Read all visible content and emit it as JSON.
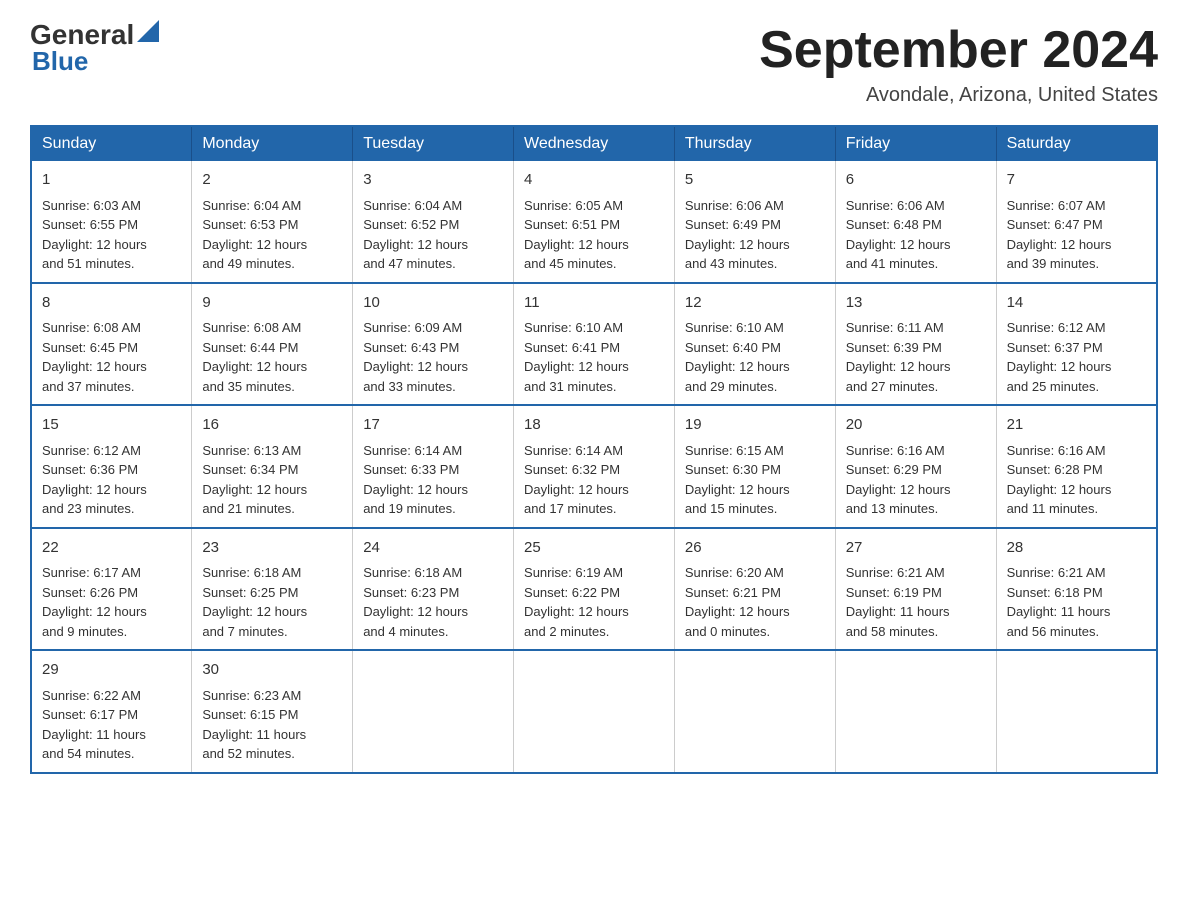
{
  "header": {
    "logo_line1": "General",
    "logo_line2": "Blue",
    "month_title": "September 2024",
    "location": "Avondale, Arizona, United States"
  },
  "days_of_week": [
    "Sunday",
    "Monday",
    "Tuesday",
    "Wednesday",
    "Thursday",
    "Friday",
    "Saturday"
  ],
  "weeks": [
    [
      {
        "day": "1",
        "sunrise": "6:03 AM",
        "sunset": "6:55 PM",
        "daylight": "12 hours and 51 minutes."
      },
      {
        "day": "2",
        "sunrise": "6:04 AM",
        "sunset": "6:53 PM",
        "daylight": "12 hours and 49 minutes."
      },
      {
        "day": "3",
        "sunrise": "6:04 AM",
        "sunset": "6:52 PM",
        "daylight": "12 hours and 47 minutes."
      },
      {
        "day": "4",
        "sunrise": "6:05 AM",
        "sunset": "6:51 PM",
        "daylight": "12 hours and 45 minutes."
      },
      {
        "day": "5",
        "sunrise": "6:06 AM",
        "sunset": "6:49 PM",
        "daylight": "12 hours and 43 minutes."
      },
      {
        "day": "6",
        "sunrise": "6:06 AM",
        "sunset": "6:48 PM",
        "daylight": "12 hours and 41 minutes."
      },
      {
        "day": "7",
        "sunrise": "6:07 AM",
        "sunset": "6:47 PM",
        "daylight": "12 hours and 39 minutes."
      }
    ],
    [
      {
        "day": "8",
        "sunrise": "6:08 AM",
        "sunset": "6:45 PM",
        "daylight": "12 hours and 37 minutes."
      },
      {
        "day": "9",
        "sunrise": "6:08 AM",
        "sunset": "6:44 PM",
        "daylight": "12 hours and 35 minutes."
      },
      {
        "day": "10",
        "sunrise": "6:09 AM",
        "sunset": "6:43 PM",
        "daylight": "12 hours and 33 minutes."
      },
      {
        "day": "11",
        "sunrise": "6:10 AM",
        "sunset": "6:41 PM",
        "daylight": "12 hours and 31 minutes."
      },
      {
        "day": "12",
        "sunrise": "6:10 AM",
        "sunset": "6:40 PM",
        "daylight": "12 hours and 29 minutes."
      },
      {
        "day": "13",
        "sunrise": "6:11 AM",
        "sunset": "6:39 PM",
        "daylight": "12 hours and 27 minutes."
      },
      {
        "day": "14",
        "sunrise": "6:12 AM",
        "sunset": "6:37 PM",
        "daylight": "12 hours and 25 minutes."
      }
    ],
    [
      {
        "day": "15",
        "sunrise": "6:12 AM",
        "sunset": "6:36 PM",
        "daylight": "12 hours and 23 minutes."
      },
      {
        "day": "16",
        "sunrise": "6:13 AM",
        "sunset": "6:34 PM",
        "daylight": "12 hours and 21 minutes."
      },
      {
        "day": "17",
        "sunrise": "6:14 AM",
        "sunset": "6:33 PM",
        "daylight": "12 hours and 19 minutes."
      },
      {
        "day": "18",
        "sunrise": "6:14 AM",
        "sunset": "6:32 PM",
        "daylight": "12 hours and 17 minutes."
      },
      {
        "day": "19",
        "sunrise": "6:15 AM",
        "sunset": "6:30 PM",
        "daylight": "12 hours and 15 minutes."
      },
      {
        "day": "20",
        "sunrise": "6:16 AM",
        "sunset": "6:29 PM",
        "daylight": "12 hours and 13 minutes."
      },
      {
        "day": "21",
        "sunrise": "6:16 AM",
        "sunset": "6:28 PM",
        "daylight": "12 hours and 11 minutes."
      }
    ],
    [
      {
        "day": "22",
        "sunrise": "6:17 AM",
        "sunset": "6:26 PM",
        "daylight": "12 hours and 9 minutes."
      },
      {
        "day": "23",
        "sunrise": "6:18 AM",
        "sunset": "6:25 PM",
        "daylight": "12 hours and 7 minutes."
      },
      {
        "day": "24",
        "sunrise": "6:18 AM",
        "sunset": "6:23 PM",
        "daylight": "12 hours and 4 minutes."
      },
      {
        "day": "25",
        "sunrise": "6:19 AM",
        "sunset": "6:22 PM",
        "daylight": "12 hours and 2 minutes."
      },
      {
        "day": "26",
        "sunrise": "6:20 AM",
        "sunset": "6:21 PM",
        "daylight": "12 hours and 0 minutes."
      },
      {
        "day": "27",
        "sunrise": "6:21 AM",
        "sunset": "6:19 PM",
        "daylight": "11 hours and 58 minutes."
      },
      {
        "day": "28",
        "sunrise": "6:21 AM",
        "sunset": "6:18 PM",
        "daylight": "11 hours and 56 minutes."
      }
    ],
    [
      {
        "day": "29",
        "sunrise": "6:22 AM",
        "sunset": "6:17 PM",
        "daylight": "11 hours and 54 minutes."
      },
      {
        "day": "30",
        "sunrise": "6:23 AM",
        "sunset": "6:15 PM",
        "daylight": "11 hours and 52 minutes."
      },
      null,
      null,
      null,
      null,
      null
    ]
  ],
  "labels": {
    "sunrise": "Sunrise:",
    "sunset": "Sunset:",
    "daylight": "Daylight:"
  }
}
